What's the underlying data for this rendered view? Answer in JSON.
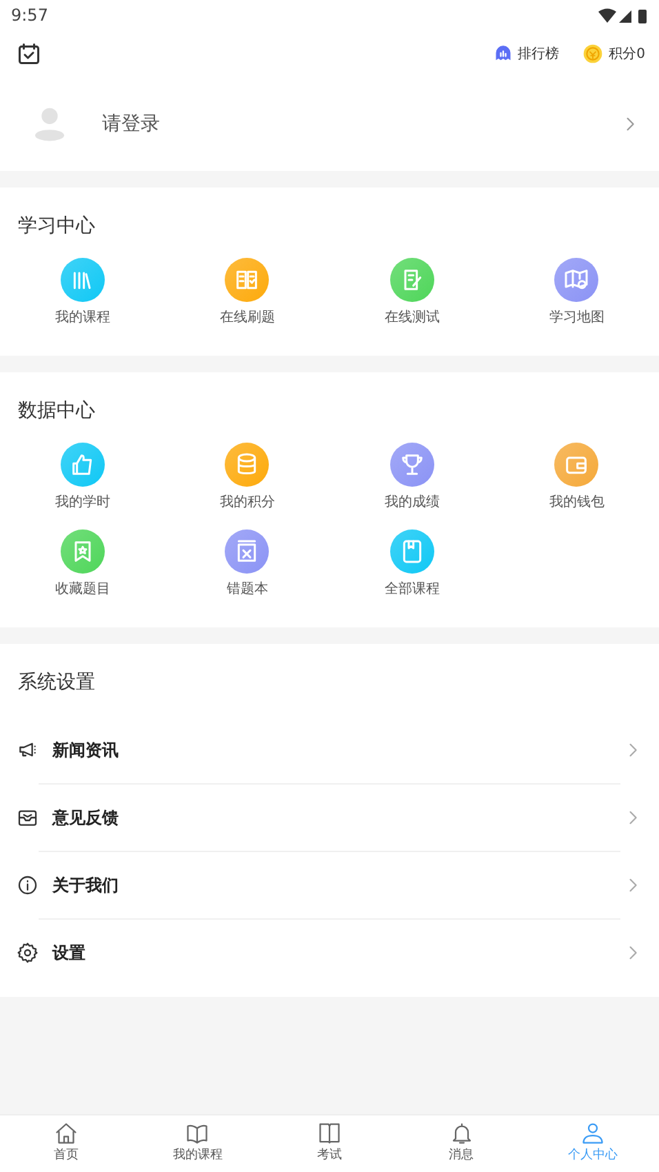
{
  "status_bar": {
    "time": "9:57"
  },
  "header": {
    "ranking": "排行榜",
    "points": "积分0"
  },
  "login": {
    "label": "请登录"
  },
  "learning_center": {
    "title": "学习中心",
    "items": [
      {
        "label": "我的课程",
        "color": "#10c8f5"
      },
      {
        "label": "在线刷题",
        "color": "#fdaa0c"
      },
      {
        "label": "在线测试",
        "color": "#4fd65a"
      },
      {
        "label": "学习地图",
        "color": "#8b93f5"
      }
    ]
  },
  "data_center": {
    "title": "数据中心",
    "items": [
      {
        "label": "我的学时",
        "color": "#10c8f5"
      },
      {
        "label": "我的积分",
        "color": "#fdaa0c"
      },
      {
        "label": "我的成绩",
        "color": "#8b93f5"
      },
      {
        "label": "我的钱包",
        "color": "#f5a93a"
      },
      {
        "label": "收藏题目",
        "color": "#4fd65a"
      },
      {
        "label": "错题本",
        "color": "#8b93f5"
      },
      {
        "label": "全部课程",
        "color": "#10c8f5"
      }
    ]
  },
  "settings": {
    "title": "系统设置",
    "items": [
      {
        "label": "新闻资讯"
      },
      {
        "label": "意见反馈"
      },
      {
        "label": "关于我们"
      },
      {
        "label": "设置"
      }
    ]
  },
  "bottom_nav": [
    {
      "label": "首页",
      "selected": false
    },
    {
      "label": "我的课程",
      "selected": false
    },
    {
      "label": "考试",
      "selected": false
    },
    {
      "label": "消息",
      "selected": false
    },
    {
      "label": "个人中心",
      "selected": true
    }
  ]
}
